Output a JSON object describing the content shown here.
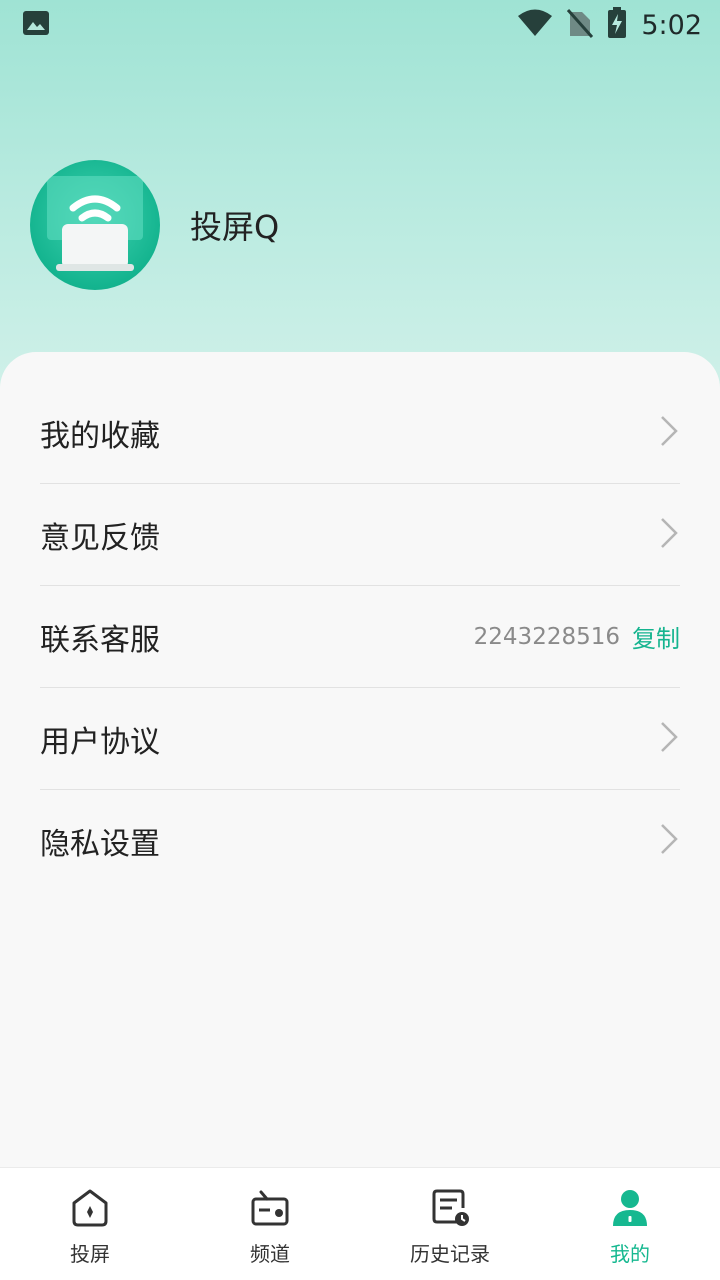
{
  "status_bar": {
    "time": "5:02"
  },
  "profile": {
    "name": "投屏Q"
  },
  "menu": [
    {
      "label": "我的收藏"
    },
    {
      "label": "意见反馈"
    },
    {
      "label": "联系客服",
      "qq": "2243228516",
      "action": "复制"
    },
    {
      "label": "用户协议"
    },
    {
      "label": "隐私设置"
    }
  ],
  "tabs": [
    {
      "label": "投屏",
      "icon": "home-icon"
    },
    {
      "label": "频道",
      "icon": "radio-icon"
    },
    {
      "label": "历史记录",
      "icon": "history-icon"
    },
    {
      "label": "我的",
      "icon": "person-icon",
      "active": true
    }
  ],
  "colors": {
    "accent": "#16b890",
    "hero_top": "#9fe3d4",
    "hero_bottom": "#d3f1ea"
  }
}
